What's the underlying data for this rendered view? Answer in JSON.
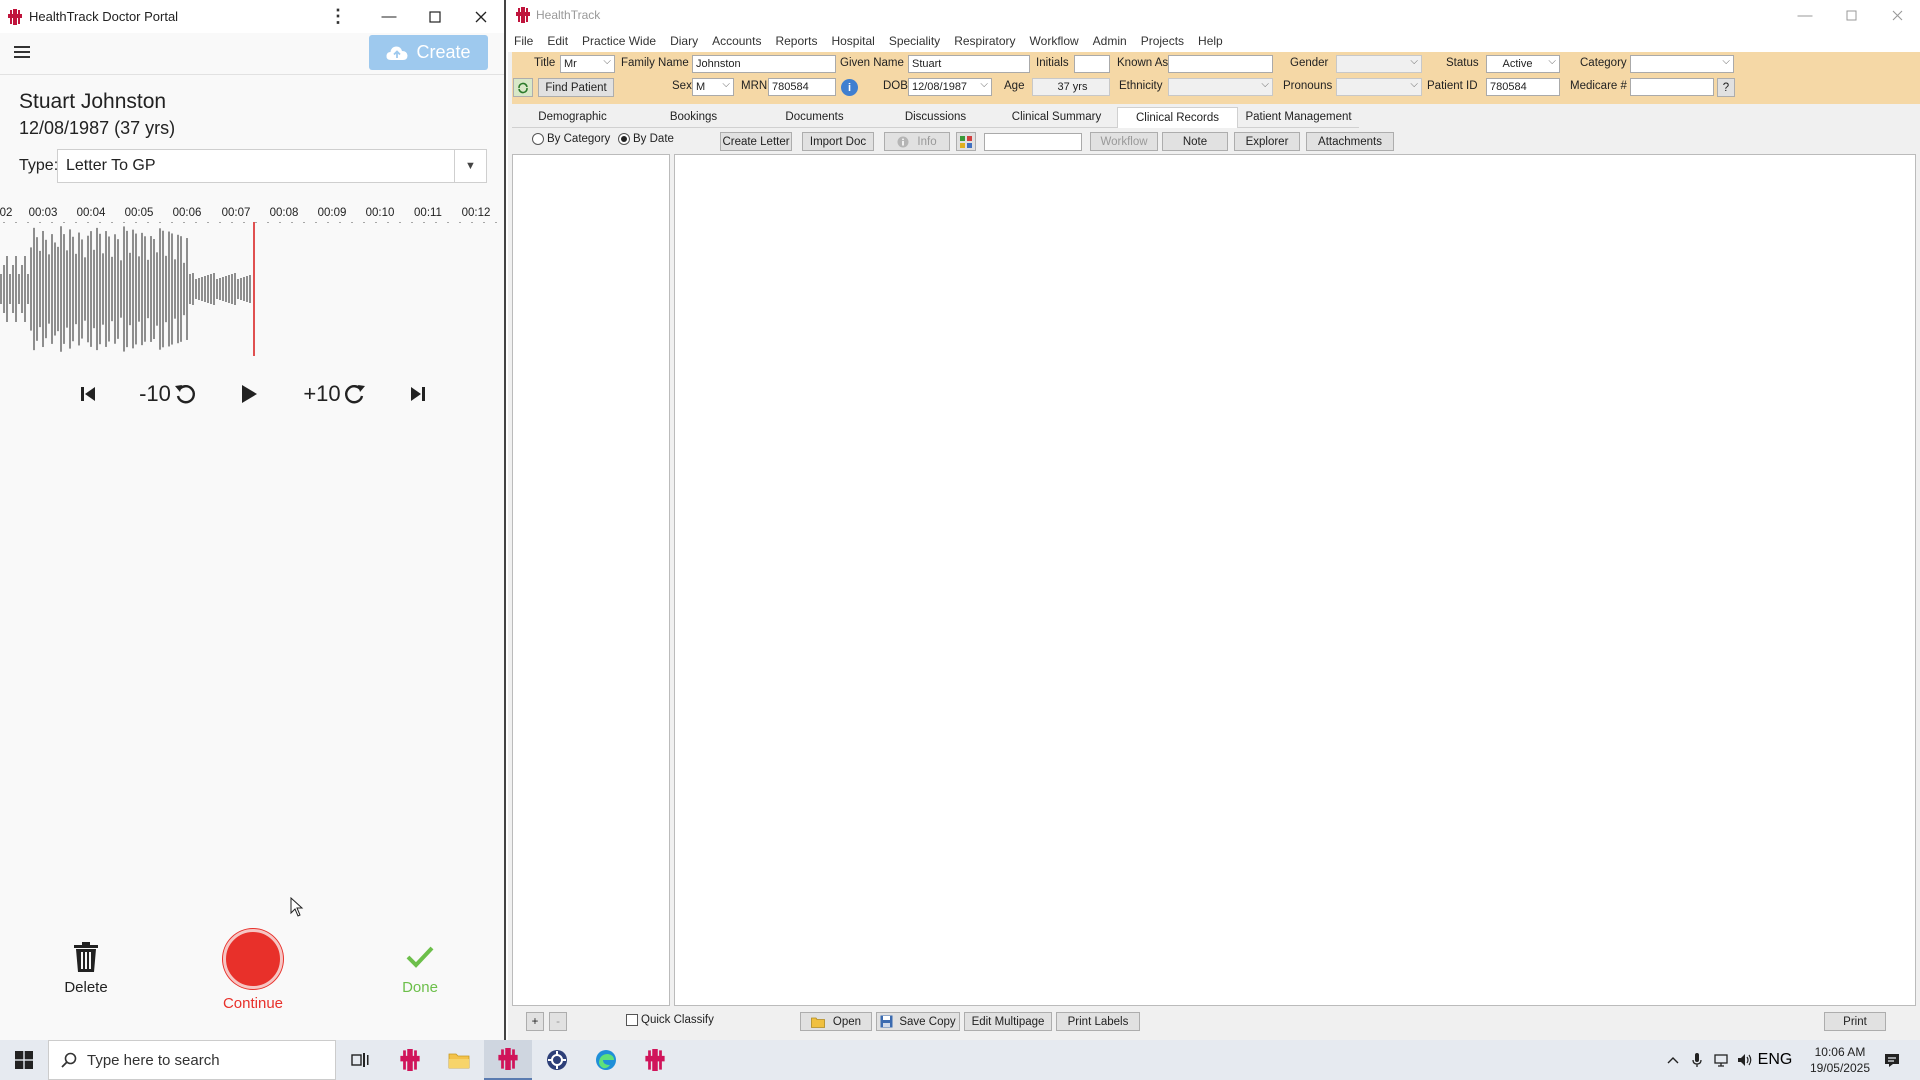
{
  "portal": {
    "title": "HealthTrack Doctor Portal",
    "menu_glyph": "⋮",
    "create_label": "Create",
    "patient_name": "Stuart Johnston",
    "patient_dob": "12/08/1987 (37 yrs)",
    "type_label": "Type:",
    "type_value": "Letter To GP",
    "timeline_ticks": [
      "02",
      "00:03",
      "00:04",
      "00:05",
      "00:06",
      "00:07",
      "00:08",
      "00:09",
      "00:10",
      "00:11",
      "00:12"
    ],
    "skip_back_label": "-10",
    "skip_forward_label": "+10",
    "delete_label": "Delete",
    "continue_label": "Continue",
    "done_label": "Done",
    "colors": {
      "record": "#e8302a",
      "done": "#6cbf4a",
      "create_bg": "#9ec9ee",
      "playhead": "#e05050"
    }
  },
  "ht": {
    "title": "HealthTrack",
    "menu": [
      "File",
      "Edit",
      "Practice Wide",
      "Diary",
      "Accounts",
      "Reports",
      "Hospital",
      "Speciality",
      "Respiratory",
      "Workflow",
      "Admin",
      "Projects",
      "Help"
    ],
    "fields": {
      "title_label": "Title",
      "title_value": "Mr",
      "family_label": "Family Name",
      "family_value": "Johnston",
      "given_label": "Given Name",
      "given_value": "Stuart",
      "initials_label": "Initials",
      "initials_value": "",
      "known_label": "Known As",
      "known_value": "",
      "gender_label": "Gender",
      "gender_value": "",
      "status_label": "Status",
      "status_value": "Active",
      "category_label": "Category",
      "category_value": "",
      "find_patient": "Find Patient",
      "sex_label": "Sex",
      "sex_value": "M",
      "mrn_label": "MRN",
      "mrn_value": "780584",
      "dob_label": "DOB",
      "dob_value": "12/08/1987",
      "age_label": "Age",
      "age_value": "37 yrs",
      "ethnicity_label": "Ethnicity",
      "ethnicity_value": "",
      "pronouns_label": "Pronouns",
      "pronouns_value": "",
      "patient_id_label": "Patient ID",
      "patient_id_value": "780584",
      "medicare_label": "Medicare #",
      "medicare_value": "",
      "help_button": "?"
    },
    "tabs": [
      "Demographic",
      "Bookings",
      "Documents",
      "Discussions",
      "Clinical Summary",
      "Clinical Records",
      "Patient Management"
    ],
    "active_tab": "Clinical Records",
    "subtool": {
      "by_category": "By Category",
      "by_date": "By Date",
      "create_letter": "Create Letter",
      "import_doc": "Import Doc",
      "info": "Info",
      "workflow": "Workflow",
      "note": "Note",
      "explorer": "Explorer",
      "attachments": "Attachments"
    },
    "bottom": {
      "plus": "+",
      "minus": "-",
      "quick_classify": "Quick Classify",
      "open": "Open",
      "save_copy": "Save Copy",
      "edit_multipage": "Edit Multipage",
      "print_labels": "Print Labels",
      "print": "Print"
    },
    "colors": {
      "patient_panel": "#f5d8a6",
      "logo": "#c0143c"
    }
  },
  "taskbar": {
    "search_placeholder": "Type here to search",
    "lang": "ENG",
    "time": "10:06 AM",
    "date": "19/05/2025"
  }
}
